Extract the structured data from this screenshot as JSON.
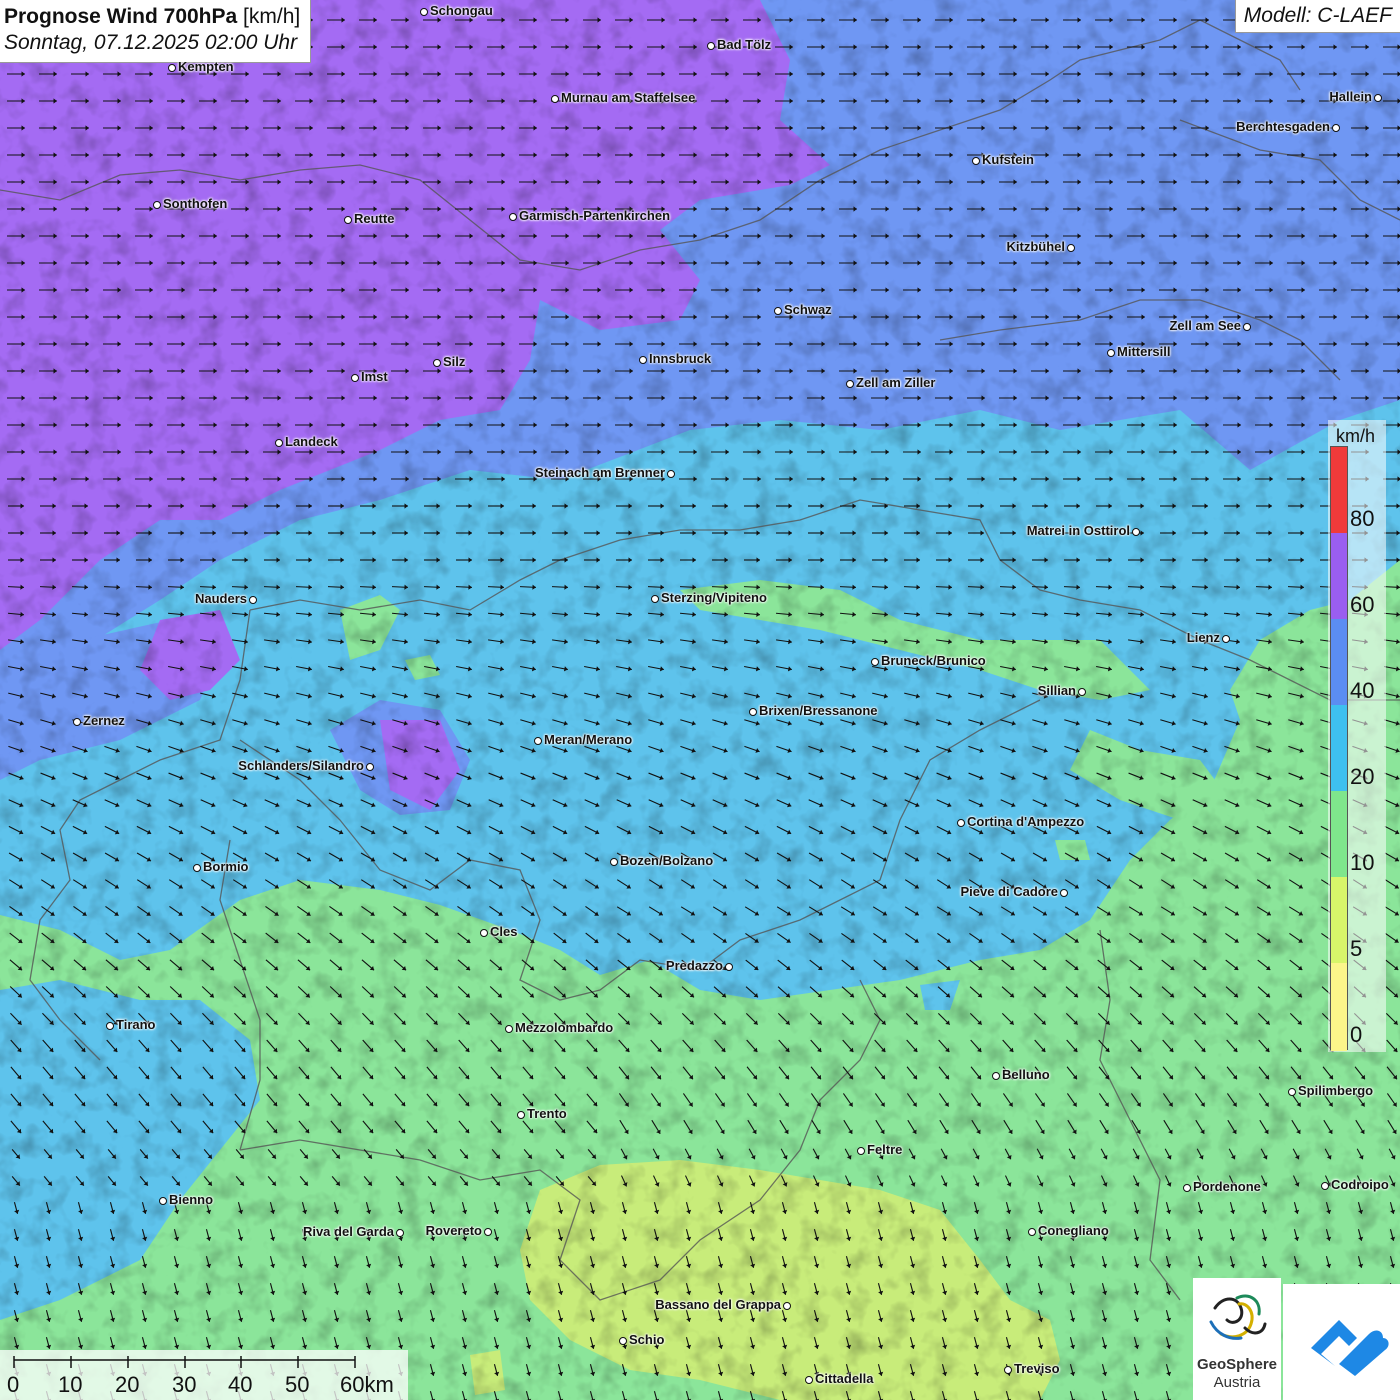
{
  "header": {
    "title": "Prognose Wind 700hPa",
    "unit": "[km/h]",
    "datetime": "Sonntag, 07.12.2025 02:00 Uhr",
    "model": "Modell: C-LAEF"
  },
  "legend": {
    "unit": "km/h",
    "labels": [
      "80",
      "60",
      "40",
      "20",
      "10",
      "5",
      "0"
    ],
    "colors": [
      "#f03a3a",
      "#9a5ef0",
      "#5b8df2",
      "#3ec0ef",
      "#7fe68c",
      "#d8f56a",
      "#fbf58a"
    ]
  },
  "scale_bar": {
    "labels": [
      "0",
      "10",
      "20",
      "30",
      "40",
      "50",
      "60km"
    ]
  },
  "logos": {
    "geosphere_name": "GeoSphere",
    "geosphere_sub": "Austria"
  },
  "colors": {
    "purple": "#a46bf3",
    "blue": "#6f97f3",
    "cyan": "#5ec3ec",
    "green": "#8be59a",
    "yellow_green": "#c3ea7e",
    "arrow": "#111111",
    "border": "#555555"
  },
  "cities": [
    {
      "name": "Schongau"
    },
    {
      "name": "Bad Tölz"
    },
    {
      "name": "Kempten"
    },
    {
      "name": "Murnau am Staffelsee"
    },
    {
      "name": "Hallein"
    },
    {
      "name": "Berchtesgaden"
    },
    {
      "name": "Kufstein"
    },
    {
      "name": "Sonthofen"
    },
    {
      "name": "Reutte"
    },
    {
      "name": "Garmisch-Partenkirchen"
    },
    {
      "name": "Kitzbühel"
    },
    {
      "name": "Schwaz"
    },
    {
      "name": "Zell am See"
    },
    {
      "name": "Mittersill"
    },
    {
      "name": "Silz"
    },
    {
      "name": "Innsbruck"
    },
    {
      "name": "Imst"
    },
    {
      "name": "Zell am Ziller"
    },
    {
      "name": "Landeck"
    },
    {
      "name": "Steinach am Brenner"
    },
    {
      "name": "Matrei in Osttirol"
    },
    {
      "name": "Nauders"
    },
    {
      "name": "Sterzing/Vipiteno"
    },
    {
      "name": "Lienz"
    },
    {
      "name": "Bruneck/Brunico"
    },
    {
      "name": "Sillian"
    },
    {
      "name": "Zernez"
    },
    {
      "name": "Brixen/Bressanone"
    },
    {
      "name": "Meran/Merano"
    },
    {
      "name": "Schlanders/Silandro"
    },
    {
      "name": "Cortina d'Ampezzo"
    },
    {
      "name": "Bozen/Bolzano"
    },
    {
      "name": "Bormio"
    },
    {
      "name": "Pieve di Cadore"
    },
    {
      "name": "Cles"
    },
    {
      "name": "Predazzo"
    },
    {
      "name": "Tirano"
    },
    {
      "name": "Mezzolombardo"
    },
    {
      "name": "Belluno"
    },
    {
      "name": "Spilimbergo"
    },
    {
      "name": "Trento"
    },
    {
      "name": "Feltre"
    },
    {
      "name": "Bienno"
    },
    {
      "name": "Pordenone"
    },
    {
      "name": "Codroipo"
    },
    {
      "name": "Riva del Garda"
    },
    {
      "name": "Rovereto"
    },
    {
      "name": "Conegliano"
    },
    {
      "name": "Bassano del Grappa"
    },
    {
      "name": "Schio"
    },
    {
      "name": "Treviso"
    },
    {
      "name": "Cittadella"
    }
  ]
}
